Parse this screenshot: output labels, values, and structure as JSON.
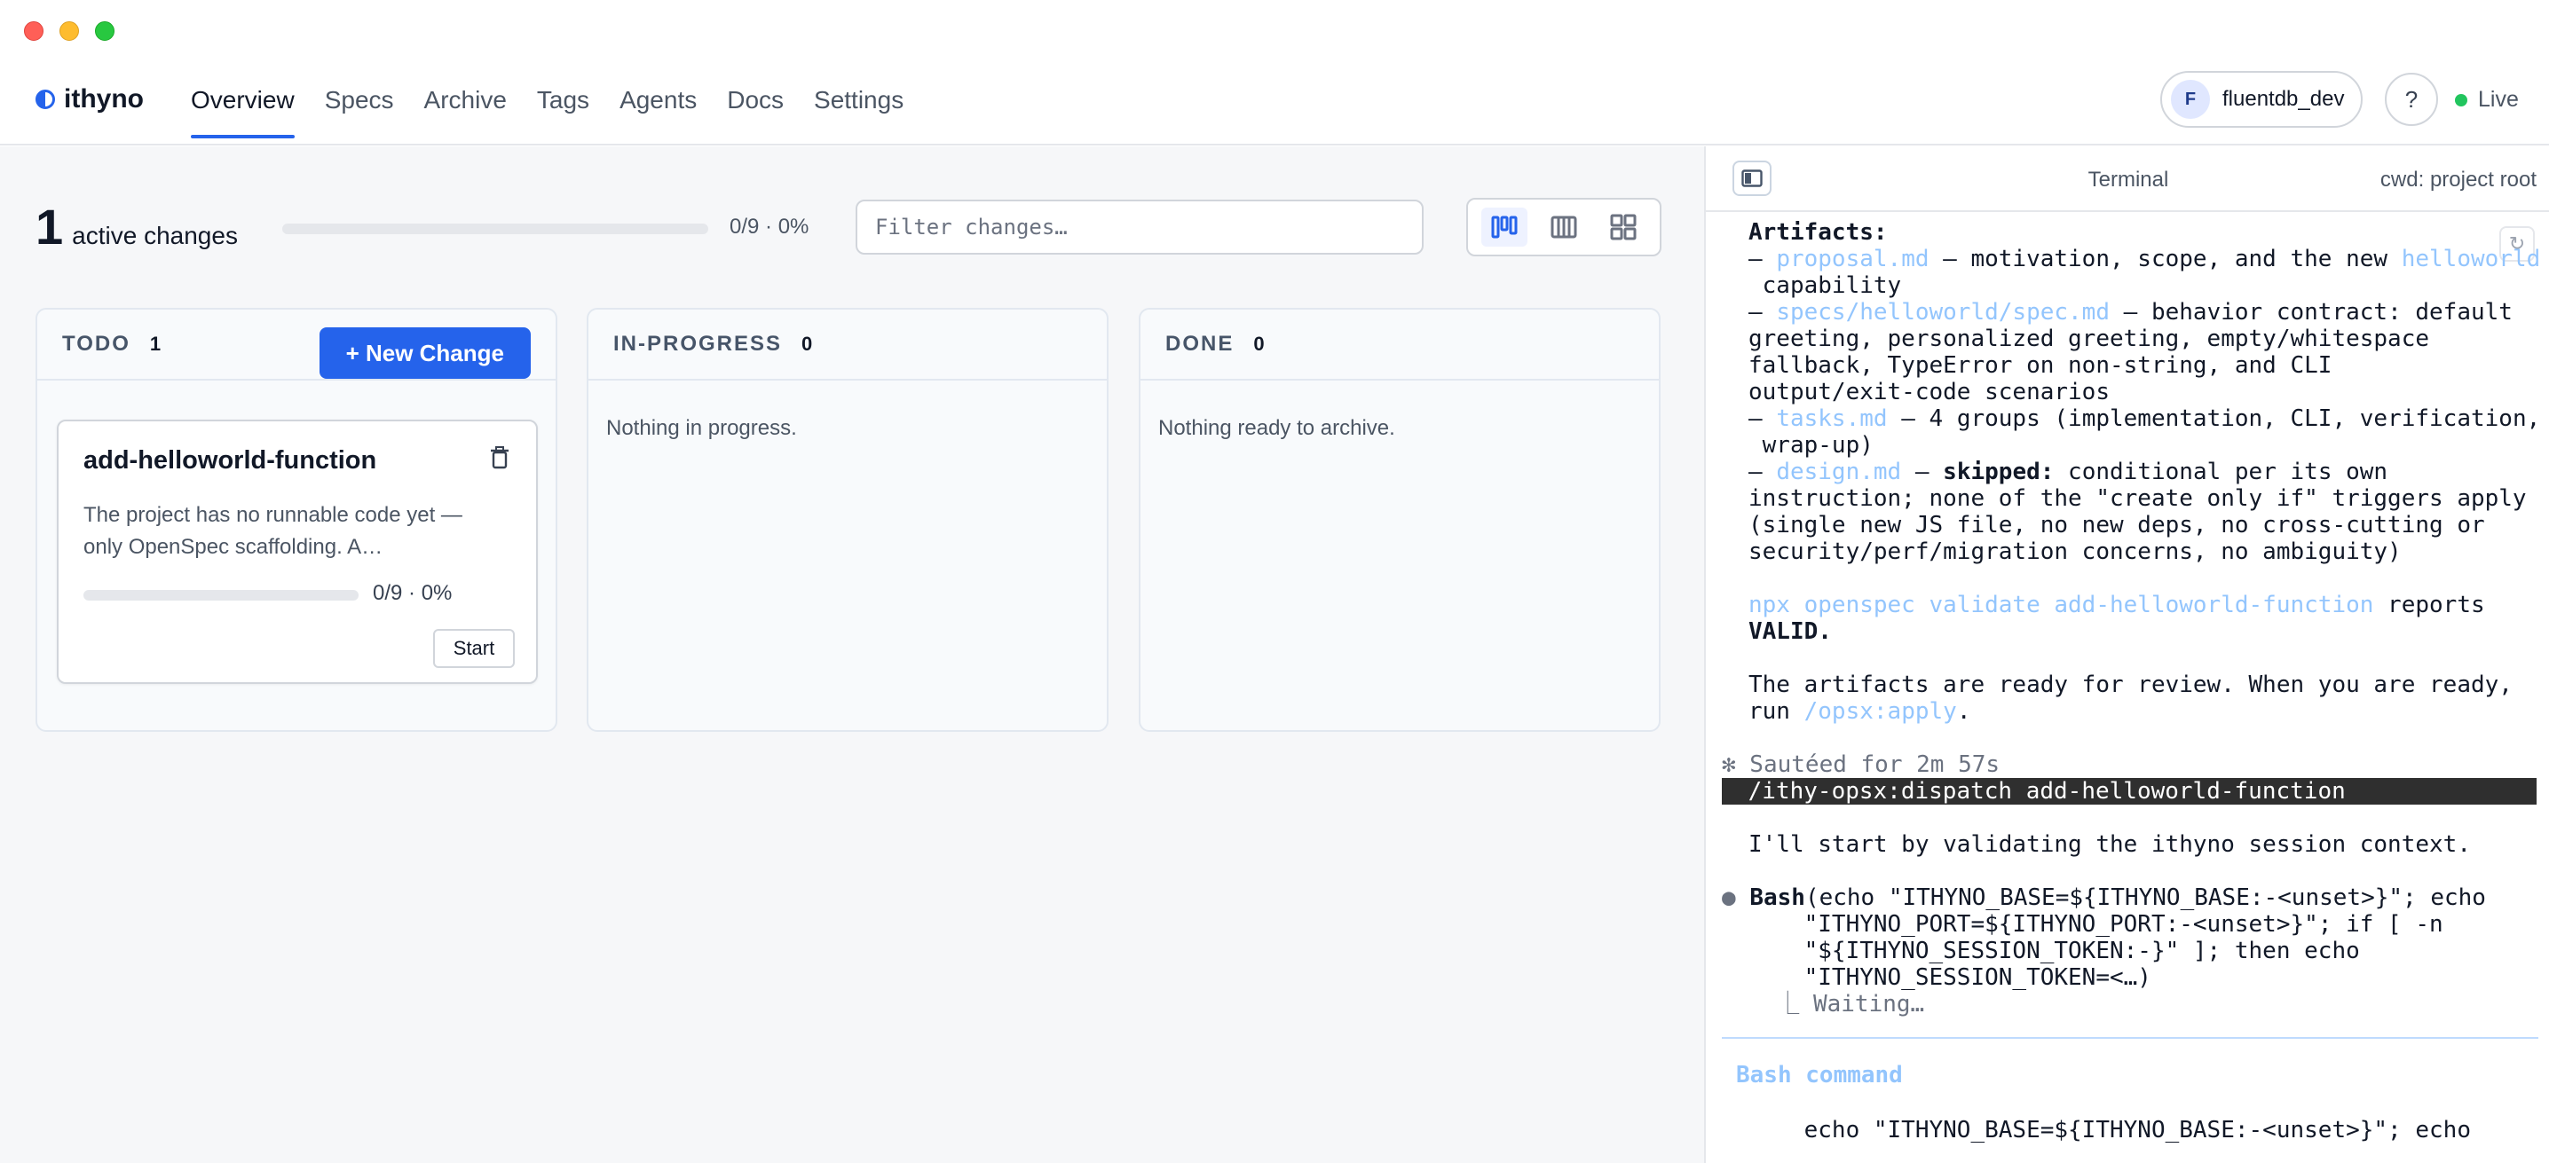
{
  "app": {
    "brand": "ithyno"
  },
  "nav": {
    "items": [
      "Overview",
      "Specs",
      "Archive",
      "Tags",
      "Agents",
      "Docs",
      "Settings"
    ],
    "active": "Overview"
  },
  "user": {
    "initial": "F",
    "name": "fluentdb_dev"
  },
  "help": {
    "label": "?"
  },
  "status": {
    "label": "Live",
    "color": "#22c55e"
  },
  "summary": {
    "count": "1",
    "label": "active changes",
    "progress": "0/9 · 0%",
    "progress_fraction": 0
  },
  "filter": {
    "placeholder": "Filter changes…",
    "value": ""
  },
  "columns": [
    {
      "title": "TODO",
      "count": "1",
      "empty": ""
    },
    {
      "title": "IN-PROGRESS",
      "count": "0",
      "empty": "Nothing in progress."
    },
    {
      "title": "DONE",
      "count": "0",
      "empty": "Nothing ready to archive."
    }
  ],
  "todo": {
    "new_button": "+ New Change"
  },
  "card": {
    "title": "add-helloworld-function",
    "description": "The project has no runnable code yet — only OpenSpec scaffolding. A…",
    "progress": "0/9 · 0%",
    "progress_fraction": 0,
    "start_label": "Start"
  },
  "terminal": {
    "title": "Terminal",
    "cwd": "cwd: project root",
    "line_artifacts": "Artifacts:",
    "l1_dash": "– ",
    "l1_link": "proposal.md",
    "l1_text": " — motivation, scope, and the new ",
    "l1_link2": "helloworld",
    "l2": " capability",
    "l3_dash": "– ",
    "l3_link": "specs/helloworld/spec.md",
    "l3_text": " — behavior contract: default",
    "l4": "greeting, personalized greeting, empty/whitespace",
    "l5": "fallback, TypeError on non-string, and CLI",
    "l6": "output/exit-code scenarios",
    "l7_dash": "– ",
    "l7_link": "tasks.md",
    "l7_text": " — 4 groups (implementation, CLI, verification,",
    "l8": " wrap-up)",
    "l9_dash": "– ",
    "l9_link": "design.md",
    "l9_sep": " — ",
    "l9_bold": "skipped:",
    "l9_text": " conditional per its own",
    "l10": "instruction; none of the \"create only if\" triggers apply",
    "l11": "(single new JS file, no new deps, no cross-cutting or",
    "l12": "security/perf/migration concerns, no ambiguity)",
    "l13_link": "npx openspec validate add-helloworld-function",
    "l13_text": " reports",
    "l14_bold": "VALID.",
    "l15": "The artifacts are ready for review. When you are ready,",
    "l16_text": "run ",
    "l16_link": "/opsx:apply",
    "l16_end": ".",
    "l17": "✻ Sautéed for 2m 57s",
    "l18": " /ithy-opsx:dispatch add-helloworld-function",
    "l19": "I'll start by validating the ithyno session context.",
    "l20_dot": "●",
    "l20_bold": "Bash",
    "l20_text": "(echo \"ITHYNO_BASE=${ITHYNO_BASE:-<unset>}\"; echo",
    "l21": "    \"ITHYNO_PORT=${ITHYNO_PORT:-<unset>}\"; if [ -n",
    "l22": "    \"${ITHYNO_SESSION_TOKEN:-}\" ]; then echo",
    "l23": "    \"ITHYNO_SESSION_TOKEN=<…)",
    "l24": "  ⎿ Waiting…",
    "l25": "Bash command",
    "l26": "    echo \"ITHYNO_BASE=${ITHYNO_BASE:-<unset>}\"; echo"
  }
}
